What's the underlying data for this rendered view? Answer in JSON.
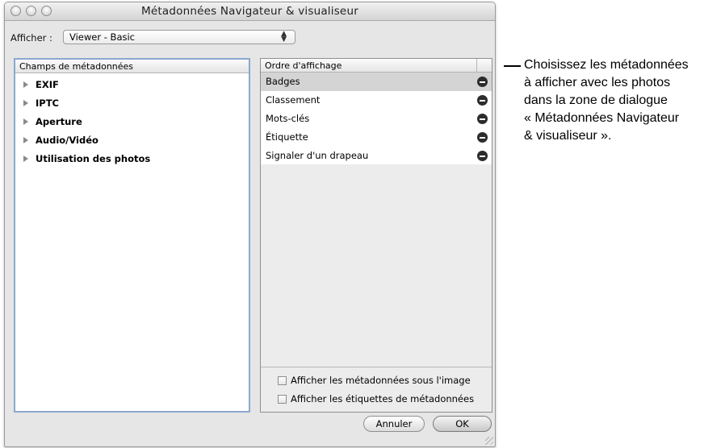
{
  "window": {
    "title": "Métadonnées Navigateur & visualiseur"
  },
  "view_selector": {
    "label": "Afficher :",
    "value": "Viewer - Basic"
  },
  "left_panel": {
    "header": "Champs de métadonnées",
    "items": [
      {
        "label": "EXIF"
      },
      {
        "label": "IPTC"
      },
      {
        "label": "Aperture"
      },
      {
        "label": "Audio/Vidéo"
      },
      {
        "label": "Utilisation des photos"
      }
    ]
  },
  "right_panel": {
    "header": "Ordre d'affichage",
    "items": [
      {
        "label": "Badges",
        "selected": true
      },
      {
        "label": "Classement",
        "selected": false
      },
      {
        "label": "Mots-clés",
        "selected": false
      },
      {
        "label": "Étiquette",
        "selected": false
      },
      {
        "label": "Signaler d'un drapeau",
        "selected": false
      }
    ],
    "checkboxes": [
      {
        "label": "Afficher les métadonnées sous l'image",
        "checked": false
      },
      {
        "label": "Afficher les étiquettes de métadonnées",
        "checked": false
      }
    ]
  },
  "buttons": {
    "cancel": "Annuler",
    "ok": "OK"
  },
  "callout": {
    "lines": [
      "Choisissez les métadonnées",
      "à afficher avec les photos",
      "dans la zone de dialogue",
      "« Métadonnées Navigateur",
      "& visualiseur »."
    ]
  }
}
